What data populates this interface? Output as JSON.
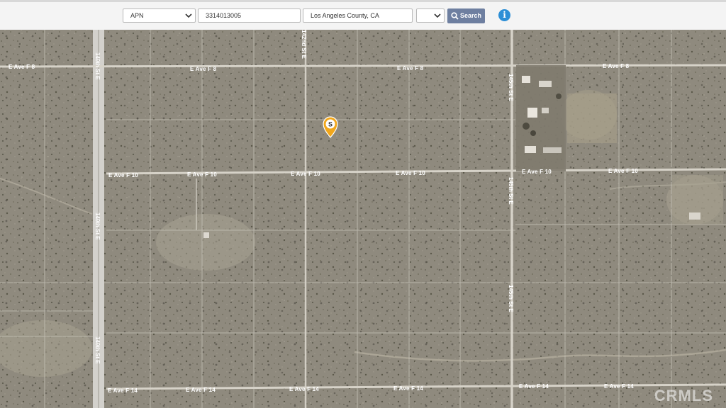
{
  "search_bar": {
    "search_type": "APN",
    "apn_value": "3314013005",
    "county_value": "Los Angeles County, CA",
    "extra_select": "",
    "search_label": "Search",
    "info_label": "i"
  },
  "map": {
    "marker_label": "S",
    "streets_horizontal": {
      "f8": "E Ave F 8",
      "f10": "E Ave F 10",
      "f14": "E Ave F 14"
    },
    "streets_vertical": {
      "st140": "140th St E",
      "st142": "142nd St E",
      "st145": "145th St E"
    },
    "watermark": "CRMLS"
  },
  "colors": {
    "toolbar_bg": "#f4f4f4",
    "search_button": "#6e7fa0",
    "info_icon": "#2d8fd6",
    "terrain": "#8f8a7e",
    "marker": "#f2a71b"
  }
}
